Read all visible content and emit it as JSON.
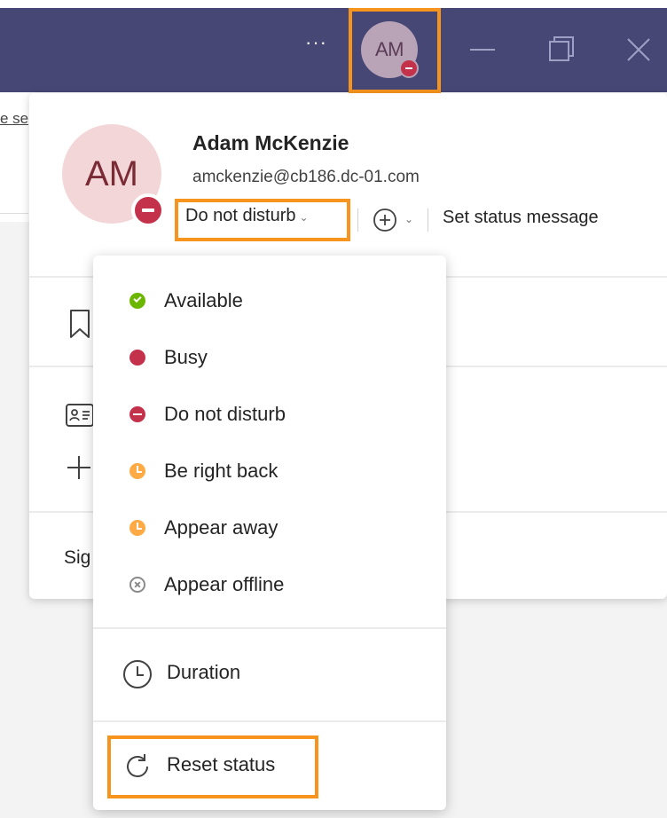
{
  "titlebar": {
    "more_label": "···",
    "avatar_initials": "AM",
    "colors": {
      "bar": "#464775",
      "avatar": "#b9a3b7"
    }
  },
  "background": {
    "link_text": "e se"
  },
  "profile": {
    "initials": "AM",
    "name": "Adam McKenzie",
    "email": "amckenzie@cb186.dc-01.com",
    "current_status": "Do not disturb",
    "set_status_message": "Set status message",
    "sign_out_fragment": "Sig"
  },
  "status_menu": {
    "items": [
      {
        "label": "Available",
        "icon": "available-status-icon",
        "color": "#6bb700"
      },
      {
        "label": "Busy",
        "icon": "busy-status-icon",
        "color": "#c4314b"
      },
      {
        "label": "Do not disturb",
        "icon": "do-not-disturb-status-icon",
        "color": "#c4314b"
      },
      {
        "label": "Be right back",
        "icon": "be-right-back-status-icon",
        "color": "#ffaa44"
      },
      {
        "label": "Appear away",
        "icon": "appear-away-status-icon",
        "color": "#ffaa44"
      },
      {
        "label": "Appear offline",
        "icon": "appear-offline-status-icon",
        "color": "#8a8a8a"
      }
    ],
    "duration_label": "Duration",
    "reset_label": "Reset status"
  },
  "accent": {
    "highlight": "#f7941d"
  }
}
